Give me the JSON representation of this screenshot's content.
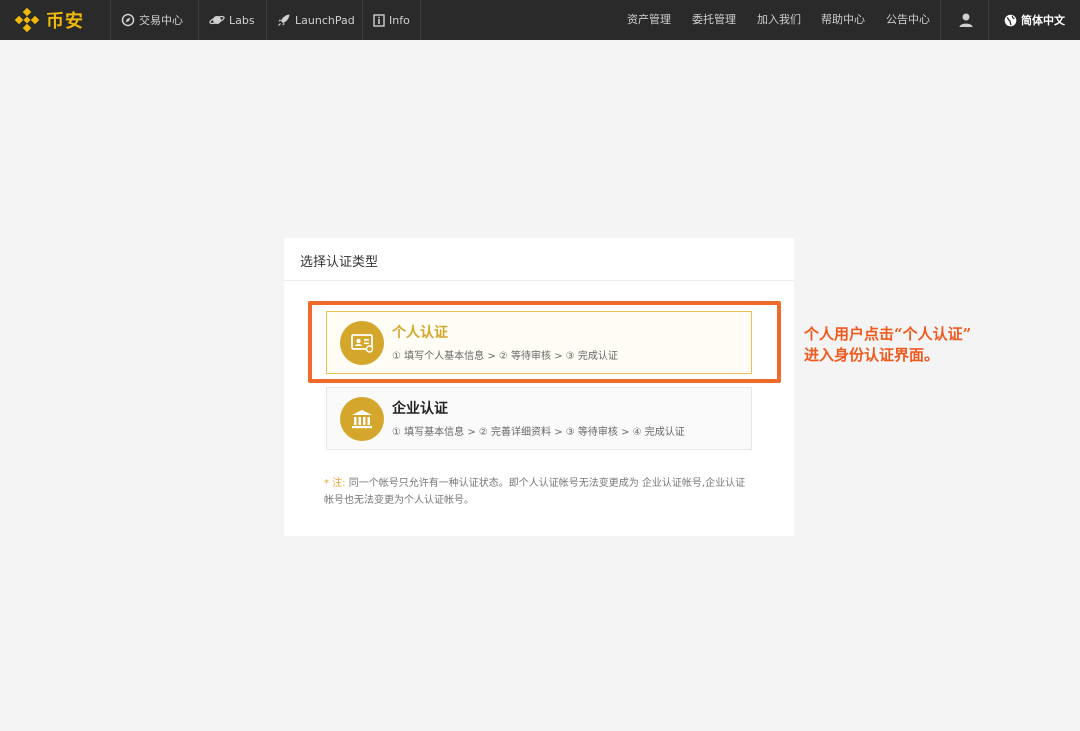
{
  "topbar": {
    "logo_text": "币安",
    "nav": [
      {
        "label": "交易中心",
        "icon": "compass-icon"
      },
      {
        "label": "Labs",
        "icon": "planet-icon"
      },
      {
        "label": "LaunchPad",
        "icon": "rocket-icon"
      },
      {
        "label": "Info",
        "icon": "info-icon"
      }
    ],
    "right_links": [
      "资产管理",
      "委托管理",
      "加入我们",
      "帮助中心",
      "公告中心"
    ],
    "language": "简体中文"
  },
  "panel": {
    "title": "选择认证类型",
    "options": [
      {
        "title": "个人认证",
        "steps": "① 填写个人基本信息 > ② 等待审核 > ③ 完成认证",
        "icon": "id-card-icon",
        "selected": true
      },
      {
        "title": "企业认证",
        "steps": "① 填写基本信息 > ② 完善详细资料 > ③ 等待审核 > ④ 完成认证",
        "icon": "bank-icon",
        "selected": false
      }
    ],
    "note_star": "* 注:",
    "note_text": "同一个帐号只允许有一种认证状态。即个人认证帐号无法变更成为 企业认证帐号,企业认证帐号也无法变更为个人认证帐号。"
  },
  "annotation": {
    "line1": "个人用户点击“个人认证”",
    "line2": "进入身份认证界面。"
  },
  "colors": {
    "accent": "#d4a72c",
    "brand": "#f0b90b",
    "highlight": "#f06a2c",
    "topbar": "#2a2a2a"
  }
}
